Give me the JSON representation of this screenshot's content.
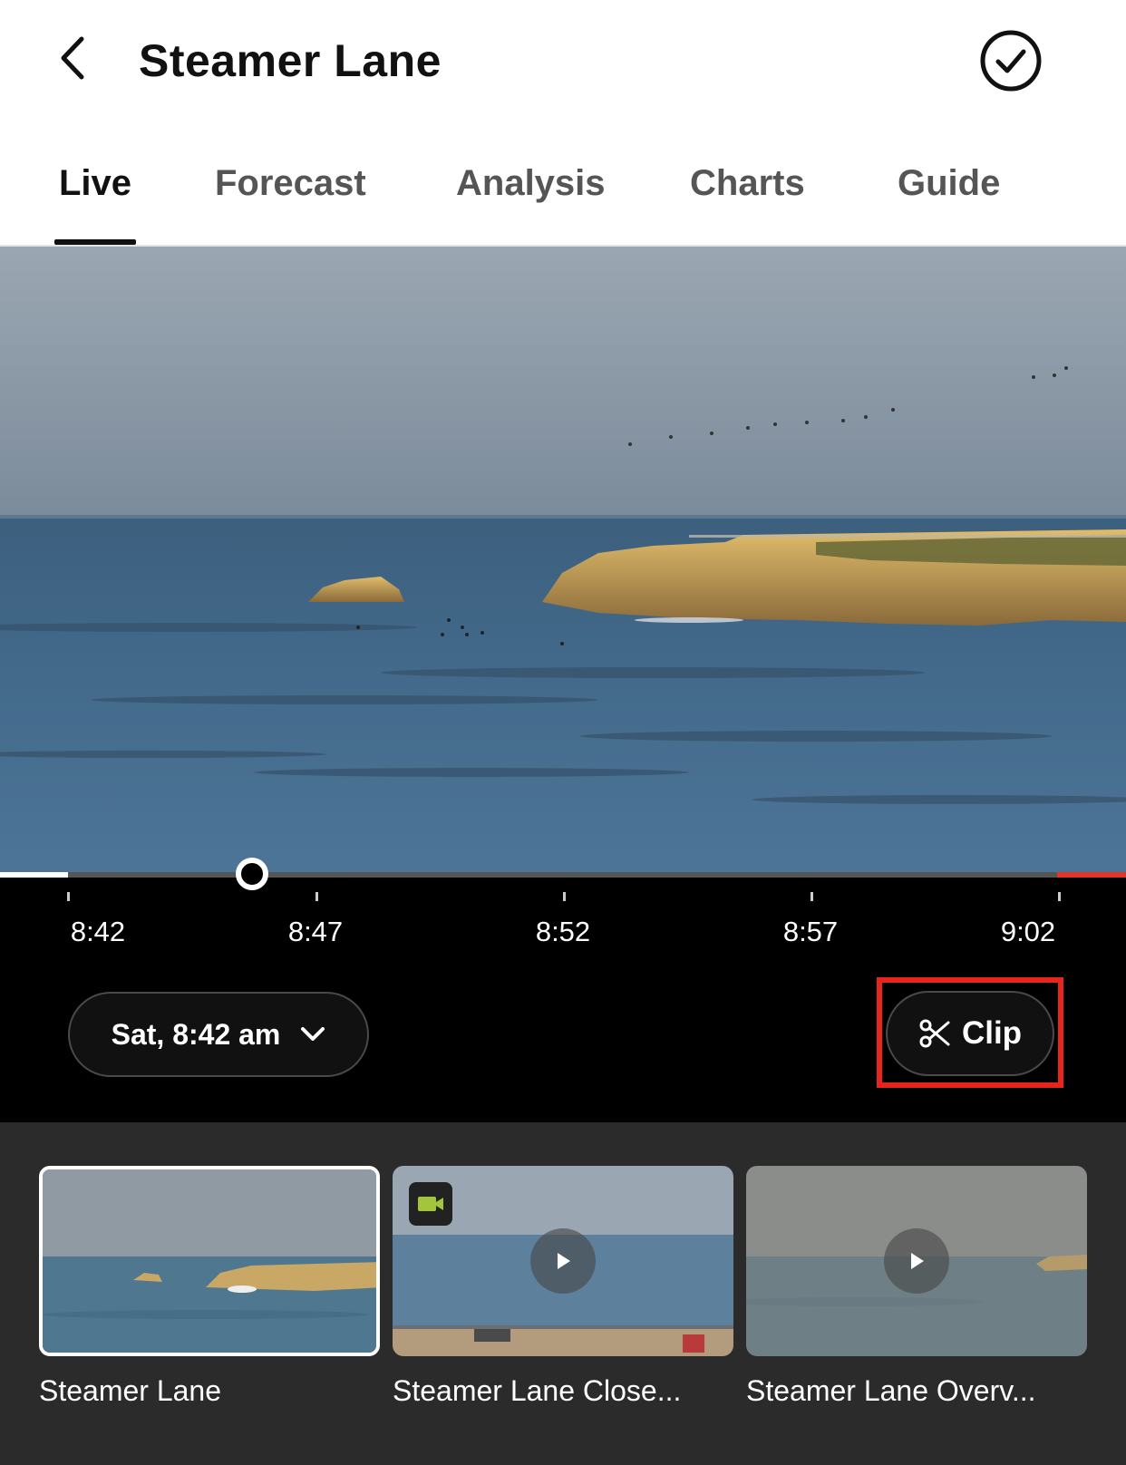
{
  "header": {
    "title": "Steamer Lane",
    "back_icon": "chevron-left-icon",
    "check_icon": "check-circle-icon"
  },
  "tabs": [
    {
      "label": "Live",
      "active": true
    },
    {
      "label": "Forecast",
      "active": false
    },
    {
      "label": "Analysis",
      "active": false
    },
    {
      "label": "Charts",
      "active": false
    },
    {
      "label": "Guide",
      "active": false
    }
  ],
  "player": {
    "timeline_ticks": [
      "8:42",
      "8:47",
      "8:52",
      "8:57",
      "9:02"
    ],
    "date_select": "Sat, 8:42 am",
    "clip_label": "Clip",
    "colors": {
      "live_indicator": "#e0352b",
      "clip_highlight": "#e8251c"
    }
  },
  "cameras": [
    {
      "label": "Steamer Lane",
      "selected": true
    },
    {
      "label": "Steamer Lane Close...",
      "selected": false
    },
    {
      "label": "Steamer Lane Overv...",
      "selected": false
    }
  ]
}
